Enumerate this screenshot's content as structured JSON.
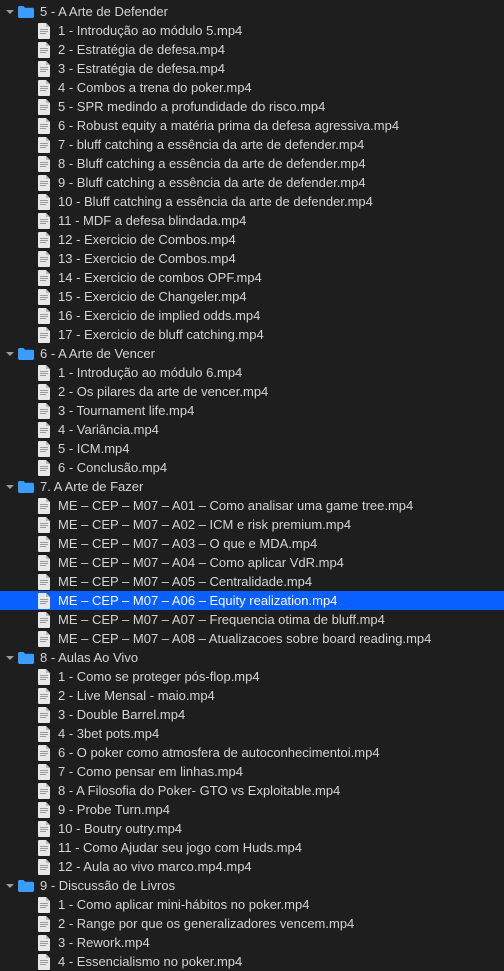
{
  "colors": {
    "background": "#1e1e1e",
    "text": "#d4d4d4",
    "selection": "#0a5fff",
    "folder": "#3b9cff",
    "chevron": "#9a9a9a",
    "filePage": "#e8e8e8",
    "fileFold": "#b8b8b8"
  },
  "tree": [
    {
      "type": "folder",
      "expanded": true,
      "label": "5 - A Arte de Defender",
      "children": [
        {
          "type": "file",
          "label": "1 - Introdução ao módulo 5.mp4"
        },
        {
          "type": "file",
          "label": "2 - Estratégia de defesa.mp4"
        },
        {
          "type": "file",
          "label": "3 - Estratégia de defesa.mp4"
        },
        {
          "type": "file",
          "label": "4 - Combos a trena do poker.mp4"
        },
        {
          "type": "file",
          "label": "5 - SPR medindo a profundidade do risco.mp4"
        },
        {
          "type": "file",
          "label": "6 - Robust equity a matéria prima da defesa agressiva.mp4"
        },
        {
          "type": "file",
          "label": "7 - bluff catching a essência da arte de defender.mp4"
        },
        {
          "type": "file",
          "label": "8 - Bluff catching a essência da arte de defender.mp4"
        },
        {
          "type": "file",
          "label": "9 - Bluff catching a essência da arte de defender.mp4"
        },
        {
          "type": "file",
          "label": "10 - Bluff catching a essência da arte de defender.mp4"
        },
        {
          "type": "file",
          "label": "11 - MDF a defesa blindada.mp4"
        },
        {
          "type": "file",
          "label": "12 - Exercicio de Combos.mp4"
        },
        {
          "type": "file",
          "label": "13 - Exercicio de Combos.mp4"
        },
        {
          "type": "file",
          "label": "14 - Exercicio de combos OPF.mp4"
        },
        {
          "type": "file",
          "label": "15 - Exercicio de Changeler.mp4"
        },
        {
          "type": "file",
          "label": "16 - Exercicio de implied odds.mp4"
        },
        {
          "type": "file",
          "label": "17 - Exercicio de bluff catching.mp4"
        }
      ]
    },
    {
      "type": "folder",
      "expanded": true,
      "label": "6 - A Arte de Vencer",
      "children": [
        {
          "type": "file",
          "label": "1 - Introdução ao módulo 6.mp4"
        },
        {
          "type": "file",
          "label": "2 - Os pilares da arte de vencer.mp4"
        },
        {
          "type": "file",
          "label": "3 - Tournament life.mp4"
        },
        {
          "type": "file",
          "label": "4 - Variância.mp4"
        },
        {
          "type": "file",
          "label": "5 - ICM.mp4"
        },
        {
          "type": "file",
          "label": "6 - Conclusão.mp4"
        }
      ]
    },
    {
      "type": "folder",
      "expanded": true,
      "label": "7. A Arte de Fazer",
      "children": [
        {
          "type": "file",
          "label": "ME – CEP – M07 – A01 – Como analisar uma game tree.mp4"
        },
        {
          "type": "file",
          "label": "ME – CEP – M07 – A02 – ICM e risk premium.mp4"
        },
        {
          "type": "file",
          "label": "ME – CEP – M07 – A03 – O que e MDA.mp4"
        },
        {
          "type": "file",
          "label": "ME – CEP – M07 – A04 – Como aplicar VdR.mp4"
        },
        {
          "type": "file",
          "label": "ME – CEP – M07 – A05 – Centralidade.mp4"
        },
        {
          "type": "file",
          "label": "ME – CEP – M07 – A06 – Equity realization.mp4",
          "selected": true
        },
        {
          "type": "file",
          "label": "ME – CEP – M07 – A07 – Frequencia otima de bluff.mp4"
        },
        {
          "type": "file",
          "label": "ME – CEP – M07 – A08 – Atualizacoes sobre board reading.mp4"
        }
      ]
    },
    {
      "type": "folder",
      "expanded": true,
      "label": "8 - Aulas Ao Vivo",
      "children": [
        {
          "type": "file",
          "label": "1 - Como se proteger pós-flop.mp4"
        },
        {
          "type": "file",
          "label": "2 - Live Mensal - maio.mp4"
        },
        {
          "type": "file",
          "label": "3 - Double Barrel.mp4"
        },
        {
          "type": "file",
          "label": "4 - 3bet pots.mp4"
        },
        {
          "type": "file",
          "label": "6 - O poker como atmosfera de autoconhecimentoi.mp4"
        },
        {
          "type": "file",
          "label": "7 - Como pensar em linhas.mp4"
        },
        {
          "type": "file",
          "label": "8 - A Filosofia do Poker- GTO vs Exploitable.mp4"
        },
        {
          "type": "file",
          "label": "9 - Probe Turn.mp4"
        },
        {
          "type": "file",
          "label": "10 - Boutry outry.mp4"
        },
        {
          "type": "file",
          "label": "11 - Como Ajudar seu jogo com Huds.mp4"
        },
        {
          "type": "file",
          "label": "12 - Aula ao vivo marco.mp4.mp4"
        }
      ]
    },
    {
      "type": "folder",
      "expanded": true,
      "label": "9 - Discussão de Livros",
      "children": [
        {
          "type": "file",
          "label": "1 - Como aplicar mini-hábitos no poker.mp4"
        },
        {
          "type": "file",
          "label": "2 - Range por que os generalizadores vencem.mp4"
        },
        {
          "type": "file",
          "label": "3 - Rework.mp4"
        },
        {
          "type": "file",
          "label": "4 - Essencialismo no poker.mp4"
        }
      ]
    }
  ]
}
